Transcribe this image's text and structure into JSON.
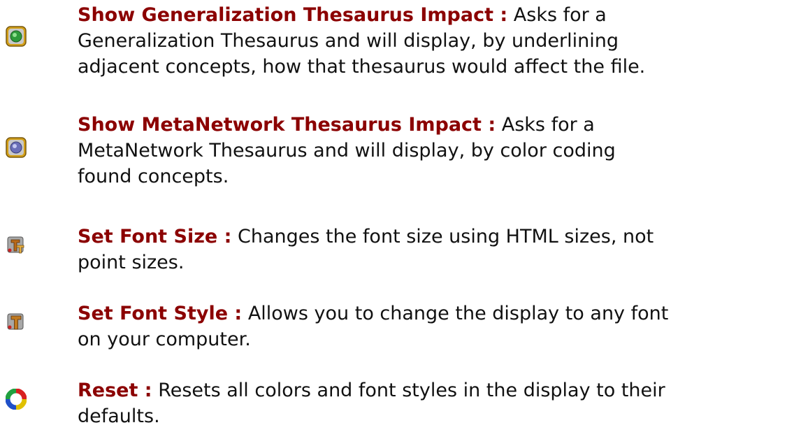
{
  "items": [
    {
      "icon": "generalization-thesaurus-impact-icon",
      "term": "Show Generalization Thesaurus Impact :",
      "desc_lines": [
        "Asks for a",
        "Generalization Thesaurus and will display, by underlining",
        "adjacent concepts, how that thesaurus would affect the file."
      ]
    },
    {
      "icon": "metanetwork-thesaurus-impact-icon",
      "term": "Show MetaNetwork Thesaurus Impact :",
      "desc_lines": [
        "Asks for a",
        "MetaNetwork Thesaurus and will display, by color coding",
        "found concepts."
      ]
    },
    {
      "icon": "font-size-icon",
      "term": "Set Font Size :",
      "desc_lines": [
        "Changes the font size using HTML sizes, not",
        "point sizes."
      ]
    },
    {
      "icon": "font-style-icon",
      "term": "Set Font Style :",
      "desc_lines": [
        "Allows you to change the display to any font",
        "on your computer."
      ]
    },
    {
      "icon": "reset-icon",
      "term": "Reset :",
      "desc_lines": [
        "Resets all colors and font styles in the display to their",
        "defaults."
      ]
    }
  ]
}
